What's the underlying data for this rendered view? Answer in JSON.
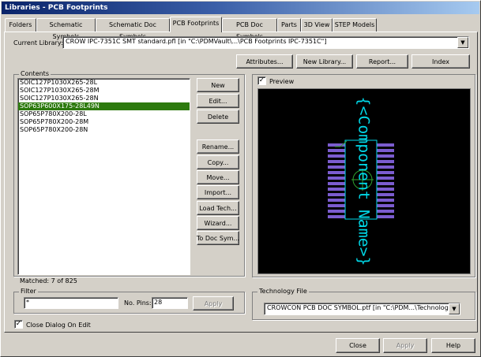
{
  "window": {
    "title": "Libraries - PCB Footprints"
  },
  "tabs": [
    "Folders",
    "Schematic Symbols",
    "Schematic Doc Symbols",
    "PCB Footprints",
    "PCB Doc Symbols",
    "Parts",
    "3D View",
    "STEP Models"
  ],
  "current_library": {
    "label": "Current Library:",
    "value": "CROW IPC-7351C SMT standard.pfl   [in \"C:\\PDMVault\\...\\PCB Footprints IPC-7351C\"]"
  },
  "top_buttons": {
    "attributes": "Attributes...",
    "new_library": "New Library...",
    "report": "Report...",
    "index": "Index"
  },
  "contents": {
    "title": "Contents",
    "items": [
      "SOIC127P1030X265-28L",
      "SOIC127P1030X265-28M",
      "SOIC127P1030X265-28N",
      "SOP63P600X175-28L49N",
      "SOP65P780X200-28L",
      "SOP65P780X200-28M",
      "SOP65P780X200-28N"
    ],
    "selected_index": 3,
    "matched": "Matched: 7 of 825"
  },
  "side_buttons": {
    "new": "New",
    "edit": "Edit...",
    "delete": "Delete",
    "rename": "Rename...",
    "copy": "Copy...",
    "move": "Move...",
    "import": "Import...",
    "load_tech": "Load Tech...",
    "wizard": "Wizard...",
    "to_doc_sym": "To Doc Sym..."
  },
  "filter": {
    "title": "Filter",
    "value": "*",
    "pins_label": "No. Pins:",
    "pins_value": "28",
    "apply": "Apply"
  },
  "preview": {
    "label": "Preview",
    "checked": true,
    "component_text": "{<Component Name>}"
  },
  "technology_file": {
    "title": "Technology File",
    "value": "CROWCON PCB DOC SYMBOL.ptf  [in \"C:\\PDM...\\Technology\"]"
  },
  "close_on_edit": {
    "label": "Close Dialog On Edit",
    "checked": true
  },
  "bottom_buttons": {
    "close": "Close",
    "apply": "Apply",
    "help": "Help"
  },
  "colors": {
    "selection": "#2d7a0e",
    "pads": "#7b5ccf",
    "outline": "#00d8e8",
    "preview_bg": "#000000"
  }
}
